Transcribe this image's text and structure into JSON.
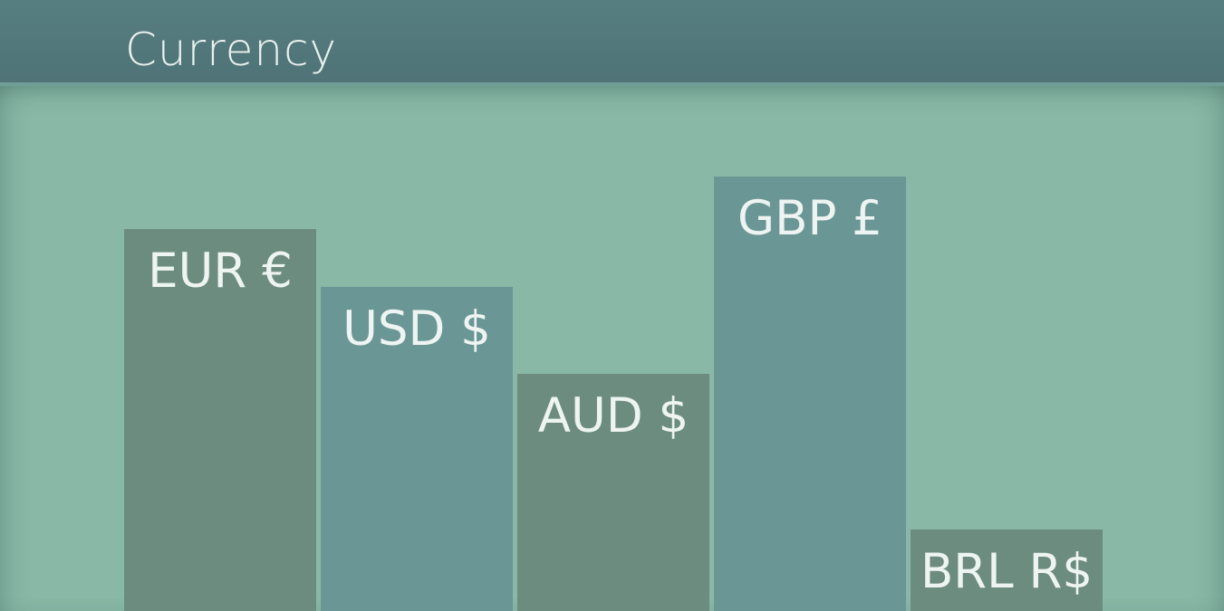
{
  "header": {
    "title": "Currency"
  },
  "colors": {
    "background": "#89b8a7",
    "header": "#527a7d",
    "bar_dark": "#6c8c80",
    "bar_teal": "#6a9796",
    "text": "#eef4f2"
  },
  "bars": [
    {
      "label": "EUR €",
      "level": 0.66,
      "color": "#6c8c80"
    },
    {
      "label": "USD $",
      "level": 0.56,
      "color": "#6a9796"
    },
    {
      "label": "AUD $",
      "level": 0.41,
      "color": "#6c8c80"
    },
    {
      "label": "GBP £",
      "level": 0.75,
      "color": "#6a9796"
    },
    {
      "label": "BRL R$",
      "level": 0.14,
      "color": "#6c8c80"
    }
  ]
}
